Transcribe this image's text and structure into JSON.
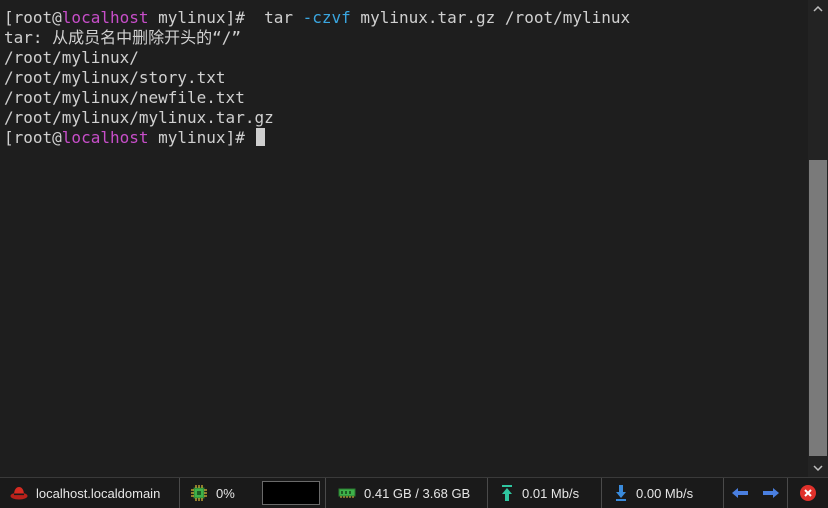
{
  "terminal": {
    "prompt_open": "[root@",
    "prompt_host": "localhost",
    "prompt_close": " mylinux]#",
    "command": {
      "cmd": "  tar ",
      "flag": "-czvf",
      "args": " mylinux.tar.gz /root/mylinux"
    },
    "output": [
      "tar: 从成员名中删除开头的“/”",
      "/root/mylinux/",
      "/root/mylinux/story.txt",
      "/root/mylinux/newfile.txt",
      "/root/mylinux/mylinux.tar.gz"
    ],
    "prompt2_open": "[root@",
    "prompt2_host": "localhost",
    "prompt2_close": " mylinux]# "
  },
  "statusbar": {
    "host": "localhost.localdomain",
    "cpu": "0%",
    "memory": "0.41 GB / 3.68 GB",
    "upload": "0.01 Mb/s",
    "download": "0.00 Mb/s"
  },
  "colors": {
    "background": "#1e1e1e",
    "text": "#d0d0d0",
    "host": "#c74ec9",
    "flag": "#3aa6e0"
  }
}
